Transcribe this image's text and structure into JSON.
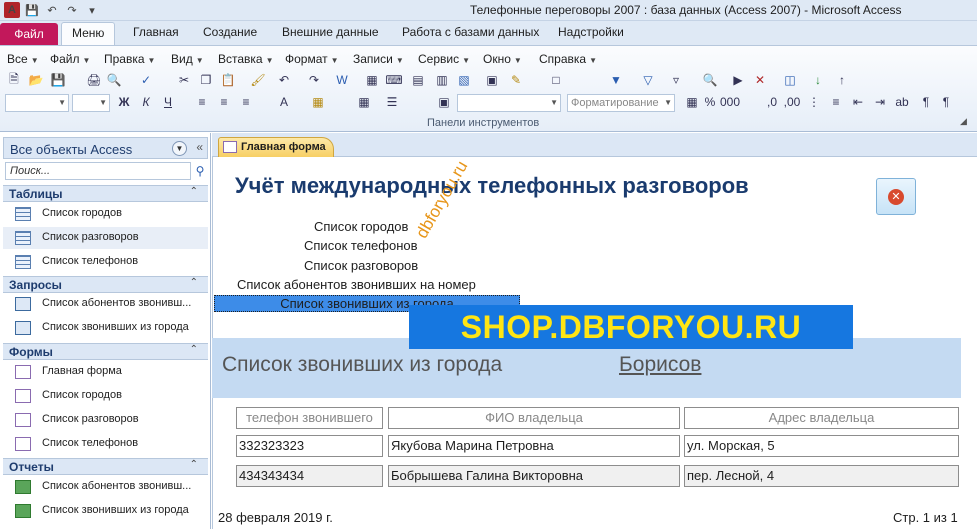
{
  "window": {
    "title": "Телефонные переговоры 2007 : база данных (Access 2007)  -  Microsoft Access",
    "app_icon_letter": "A"
  },
  "ribbon_tabs": {
    "file": "Файл",
    "items": [
      "Меню",
      "Главная",
      "Создание",
      "Внешние данные",
      "Работа с базами данных",
      "Надстройки"
    ],
    "active": "Меню"
  },
  "menu_bar": [
    "Все",
    "Файл",
    "Правка",
    "Вид",
    "Вставка",
    "Формат",
    "Записи",
    "Сервис",
    "Окно",
    "Справка"
  ],
  "toolbar": {
    "format_combo": "Форматирование",
    "group_label": "Панели инструментов"
  },
  "nav_pane": {
    "header": "Все объекты Access",
    "search_placeholder": "Поиск...",
    "groups": [
      {
        "title": "Таблицы",
        "items": [
          "Список городов",
          "Список разговоров",
          "Список телефонов"
        ]
      },
      {
        "title": "Запросы",
        "items": [
          "Список абонентов звонивш...",
          "Список звонивших из города"
        ]
      },
      {
        "title": "Формы",
        "items": [
          "Главная форма",
          "Список городов",
          "Список разговоров",
          "Список телефонов"
        ]
      },
      {
        "title": "Отчеты",
        "items": [
          "Список абонентов звонивш...",
          "Список звонивших из города"
        ]
      }
    ],
    "selected_item": "Список разговоров"
  },
  "document": {
    "tab_label": "Главная форма",
    "form_title": "Учёт международных телефонных разговоров",
    "links": [
      "Список городов",
      "Список телефонов",
      "Список разговоров",
      "Список абонентов звонивших на номер",
      "Список звонивших из города"
    ],
    "selected_link": "Список звонивших из города",
    "report": {
      "title": "Список звонивших из города",
      "city": "Борисов",
      "columns": [
        "телефон звонившего",
        "ФИО владельца",
        "Адрес владельца"
      ],
      "rows": [
        [
          "332323323",
          "Якубова Марина Петровна",
          "ул. Морская, 5"
        ],
        [
          "434343434",
          "Бобрышева Галина Викторовна",
          "пер. Лесной, 4"
        ]
      ],
      "date": "28 февраля 2019 г.",
      "page": "Стр. 1 из 1"
    }
  },
  "watermarks": {
    "banner": "SHOP.DBFORYOU.RU",
    "diagonal": "dbforyou.ru"
  }
}
